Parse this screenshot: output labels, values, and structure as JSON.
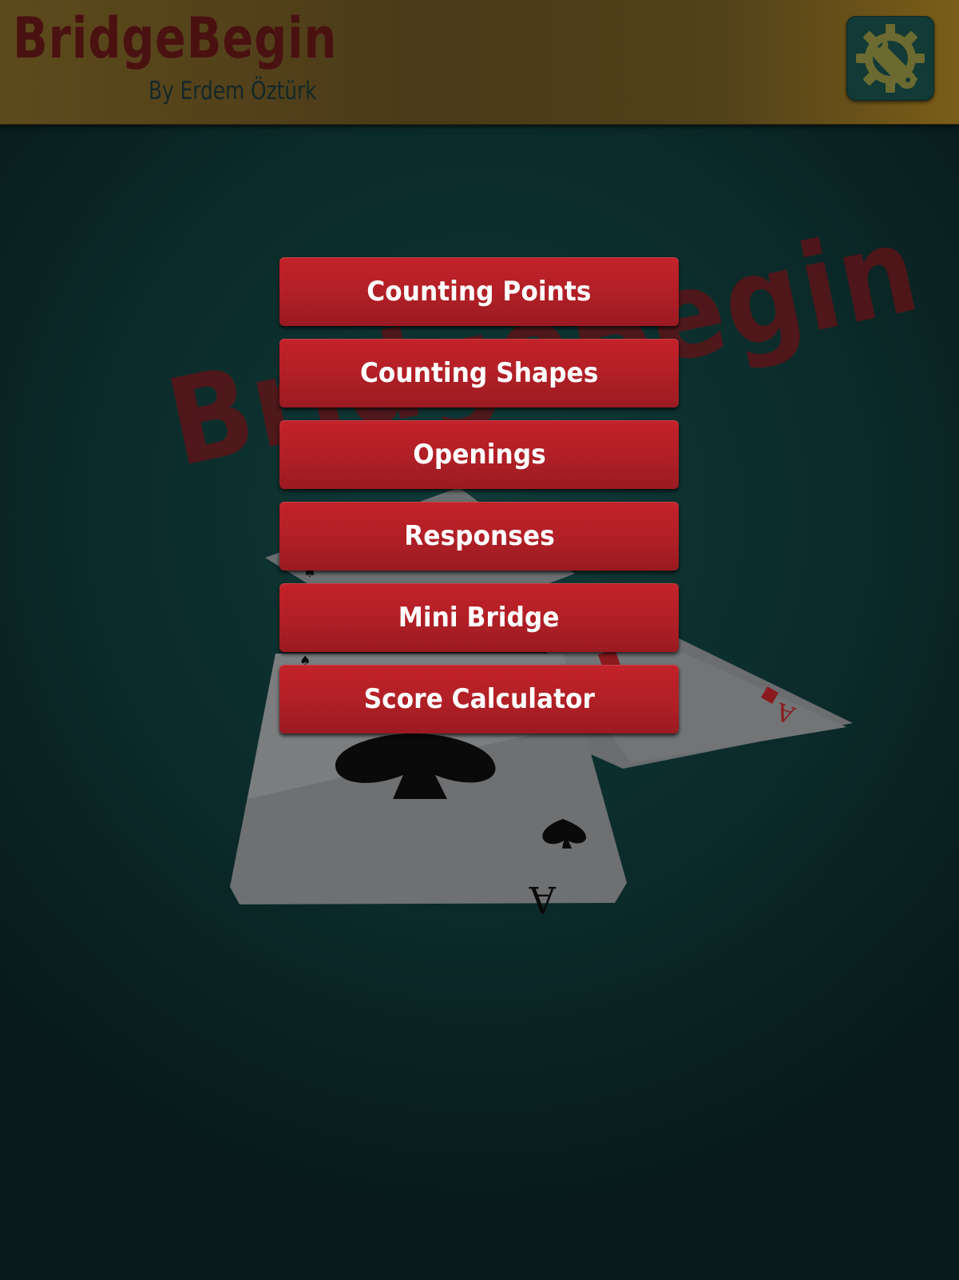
{
  "header": {
    "title": "BridgeBegin",
    "subtitle": "By Erdem Öztürk",
    "settings_icon": "gear-wrench-icon"
  },
  "background": {
    "watermark_text": "BridgeBegin",
    "cards": [
      "ace-of-spades",
      "ace-of-diamonds",
      "ace-of-diamonds"
    ]
  },
  "menu": {
    "items": [
      {
        "label": "Counting Points"
      },
      {
        "label": "Counting Shapes"
      },
      {
        "label": "Openings"
      },
      {
        "label": "Responses"
      },
      {
        "label": "Mini Bridge"
      },
      {
        "label": "Score Calculator"
      }
    ]
  },
  "colors": {
    "header": "#4a3a18",
    "title": "#4a1111",
    "button": "#b01f26",
    "background": "#0b2b2a",
    "settings_button": "#123a36",
    "settings_icon": "#6b6a30"
  }
}
